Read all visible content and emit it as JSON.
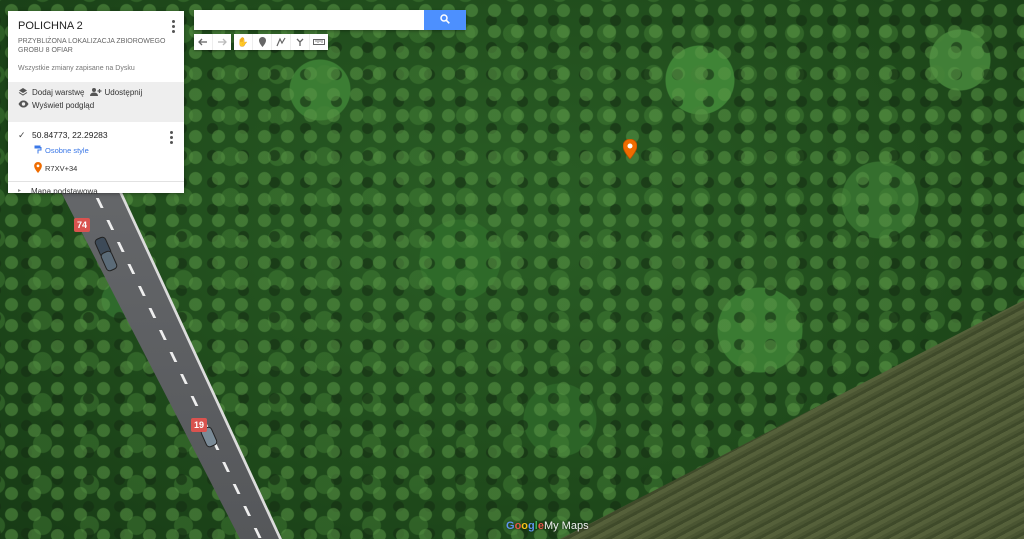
{
  "map": {
    "title": "POLICHNA 2",
    "description": "PRZYBLIŻONA LOKALIZACJA ZBIOROWEGO GROBU 8 OFIAR",
    "save_status": "Wszystkie zmiany zapisane na Dysku",
    "actions": {
      "add_layer": "Dodaj warstwę",
      "share": "Udostępnij",
      "preview": "Wyświetl podgląd"
    },
    "layer": {
      "title": "50.84773, 22.29283",
      "style_link": "Osobne style",
      "place": "R7XV+34"
    },
    "basemap_label": "Mapa podstawowa"
  },
  "search": {
    "placeholder": "",
    "value": ""
  },
  "toolbar": {
    "icons": [
      "undo-icon",
      "redo-icon",
      "hand-icon",
      "marker-icon",
      "draw-line-icon",
      "directions-icon",
      "ruler-icon"
    ]
  },
  "roads": {
    "badge_top": "74",
    "badge_bottom": "19"
  },
  "branding": {
    "logo_google": "Google",
    "logo_mymaps": "My Maps"
  },
  "colors": {
    "accent_blue": "#4d90fe",
    "marker_orange": "#ef6c00",
    "road_badge": "#d9534f"
  }
}
